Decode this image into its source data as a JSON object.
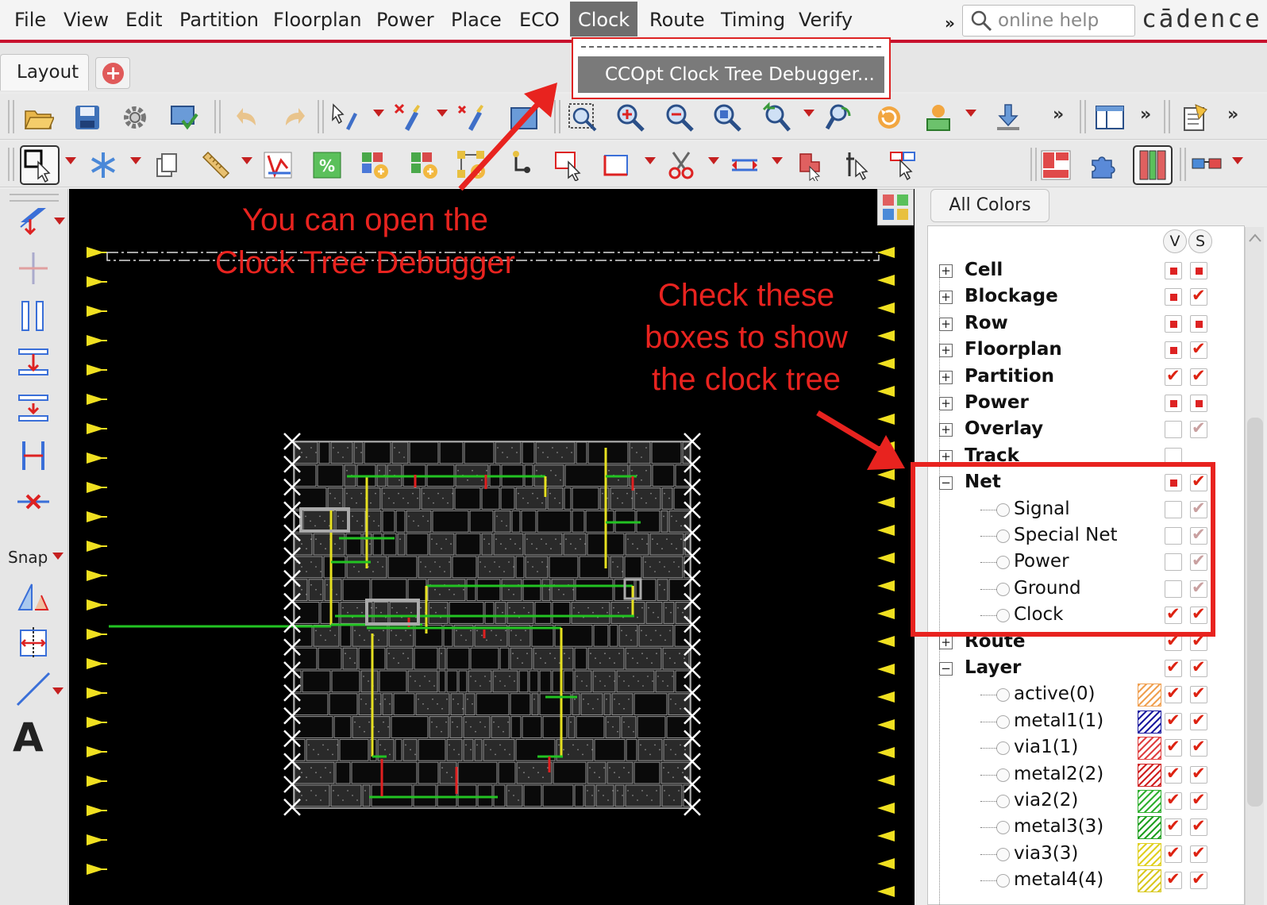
{
  "menubar": {
    "items": [
      "File",
      "View",
      "Edit",
      "Partition",
      "Floorplan",
      "Power",
      "Place",
      "ECO",
      "Clock",
      "Route",
      "Timing",
      "Verify"
    ],
    "active_item": "Clock",
    "overflow": "»",
    "help_placeholder": "online help",
    "brand": "cādence"
  },
  "tabs": {
    "layout_label": "Layout"
  },
  "dropdown": {
    "item_label": "CCOpt Clock Tree Debugger..."
  },
  "left_palette": {
    "snap_label": "Snap",
    "text_tool": "A"
  },
  "right_panel": {
    "all_colors_label": "All Colors",
    "col_v": "V",
    "col_s": "S",
    "tree": [
      {
        "label": "Cell",
        "type": "group",
        "expander": "+",
        "v": "square",
        "s": "square"
      },
      {
        "label": "Blockage",
        "type": "group",
        "expander": "+",
        "v": "square",
        "s": "check"
      },
      {
        "label": "Row",
        "type": "group",
        "expander": "+",
        "v": "square",
        "s": "square"
      },
      {
        "label": "Floorplan",
        "type": "group",
        "expander": "+",
        "v": "square",
        "s": "check"
      },
      {
        "label": "Partition",
        "type": "group",
        "expander": "+",
        "v": "check",
        "s": "check"
      },
      {
        "label": "Power",
        "type": "group",
        "expander": "+",
        "v": "square",
        "s": "square"
      },
      {
        "label": "Overlay",
        "type": "group",
        "expander": "+",
        "v": "empty",
        "s": "faint"
      },
      {
        "label": "Track",
        "type": "group",
        "expander": "+",
        "v": "empty",
        "s": "none"
      },
      {
        "label": "Net",
        "type": "group",
        "expander": "−",
        "v": "square",
        "s": "check"
      },
      {
        "label": "Signal",
        "type": "child",
        "v": "empty",
        "s": "faint"
      },
      {
        "label": "Special Net",
        "type": "child",
        "v": "empty",
        "s": "faint"
      },
      {
        "label": "Power",
        "type": "child",
        "v": "empty",
        "s": "faint"
      },
      {
        "label": "Ground",
        "type": "child",
        "v": "empty",
        "s": "faint"
      },
      {
        "label": "Clock",
        "type": "child",
        "v": "check",
        "s": "check"
      },
      {
        "label": "Route",
        "type": "group",
        "expander": "+",
        "v": "check",
        "s": "check"
      },
      {
        "label": "Layer",
        "type": "group",
        "expander": "−",
        "v": "check",
        "s": "check"
      },
      {
        "label": "active(0)",
        "type": "child",
        "swatch": "#f0a050",
        "v": "check",
        "s": "check"
      },
      {
        "label": "metal1(1)",
        "type": "child",
        "swatch": "#1a1aa0",
        "v": "check",
        "s": "check"
      },
      {
        "label": "via1(1)",
        "type": "child",
        "swatch": "#e04040",
        "v": "check",
        "s": "check"
      },
      {
        "label": "metal2(2)",
        "type": "child",
        "swatch": "#d02020",
        "v": "check",
        "s": "check"
      },
      {
        "label": "via2(2)",
        "type": "child",
        "swatch": "#30b030",
        "v": "check",
        "s": "check"
      },
      {
        "label": "metal3(3)",
        "type": "child",
        "swatch": "#20a020",
        "v": "check",
        "s": "check"
      },
      {
        "label": "via3(3)",
        "type": "child",
        "swatch": "#e0d020",
        "v": "check",
        "s": "check"
      },
      {
        "label": "metal4(4)",
        "type": "child",
        "swatch": "#d8c820",
        "v": "check",
        "s": "check"
      }
    ]
  },
  "annotations": {
    "debugger_line1": "You can open the",
    "debugger_line2": "Clock Tree Debugger",
    "boxes_line1": "Check these",
    "boxes_line2": "boxes to show",
    "boxes_line3": "the clock tree"
  },
  "colors": {
    "accent_red": "#c8102e",
    "annotation_red": "#e8231f",
    "canvas_bg": "#000000",
    "clock_net_green": "#22c322",
    "clock_net_yellow": "#e6e020",
    "pin_yellow": "#f0e020"
  },
  "icons": {
    "toolbar1": [
      "open-folder-icon",
      "save-icon",
      "settings-gear-icon",
      "screen-check-icon",
      "undo-icon",
      "redo-icon",
      "select-pen-icon",
      "delete-pen-icon",
      "move-pen-icon",
      "window-icon",
      "fit-zoom-icon",
      "zoom-in-icon",
      "zoom-out-icon",
      "zoom-select-icon",
      "zoom-previous-icon",
      "pan-icon",
      "redraw-icon",
      "highlight-icon",
      "download-icon",
      "panels-icon",
      "notes-icon"
    ],
    "toolbar2": [
      "select-mode-icon",
      "snowflake-icon",
      "copy-icon",
      "ruler-icon",
      "timing-chart-icon",
      "percent-icon",
      "cell-add-icon",
      "cell-add2-icon",
      "cell-connect-icon",
      "wire-icon",
      "pointer-box-icon",
      "resize-icon",
      "cut-icon",
      "stretch-icon",
      "shape-icon",
      "select-tool-icon",
      "multi-select-icon",
      "layout-colors-icon",
      "puzzle-icon",
      "columns-icon",
      "glasses-icon"
    ]
  }
}
